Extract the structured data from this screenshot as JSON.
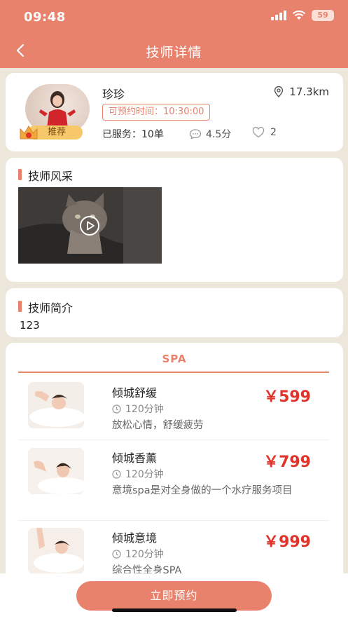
{
  "status_bar": {
    "time": "09:48",
    "battery": "59"
  },
  "header": {
    "title": "技师详情"
  },
  "profile": {
    "name": "珍珍",
    "distance": "17.3km",
    "available_time": "可预约时间：10:30:00",
    "served": "已服务：10单",
    "rating": "4.5分",
    "likes": "2",
    "badge": "推荐"
  },
  "style_section": {
    "title": "技师风采"
  },
  "intro_section": {
    "title": "技师简介",
    "text": "123"
  },
  "services_tab": "SPA",
  "services": [
    {
      "name": "倾城舒缓",
      "duration": "120分钟",
      "desc": "放松心情，舒缓疲劳",
      "price": "￥599"
    },
    {
      "name": "倾城香薰",
      "duration": "120分钟",
      "desc": "意境spa是对全身做的一个水疗服务项目",
      "price": "￥799"
    },
    {
      "name": "倾城意境",
      "duration": "120分钟",
      "desc": "综合性全身SPA",
      "price": "￥999"
    }
  ],
  "book_button": "立即预约",
  "colors": {
    "accent": "#e9826c",
    "price": "#e0332a",
    "badge": "#f6c86a"
  }
}
